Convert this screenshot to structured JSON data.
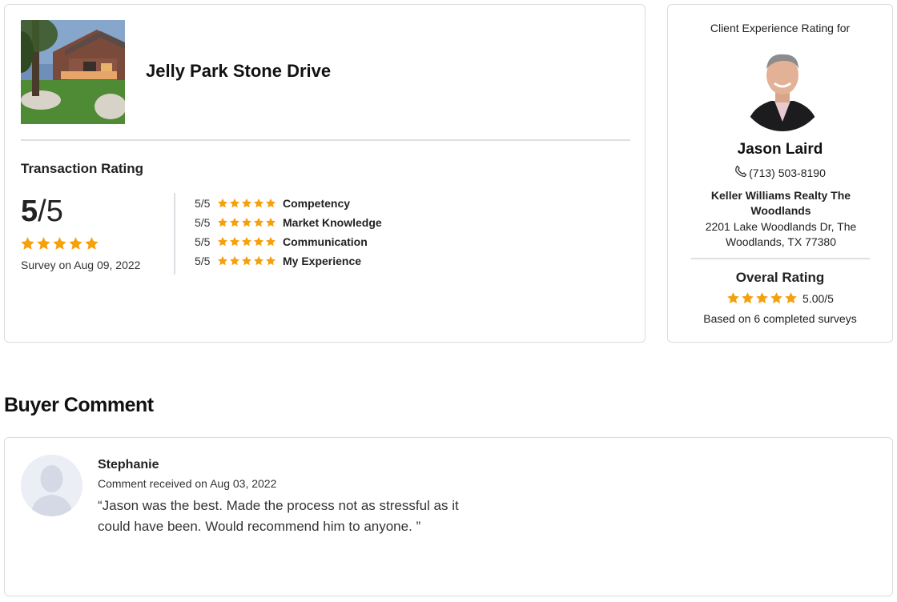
{
  "transaction": {
    "property_name": "Jelly Park Stone Drive",
    "heading": "Transaction Rating",
    "score": "5",
    "score_suffix": "/5",
    "stars": 5,
    "survey_date": "Survey on Aug 09, 2022",
    "criteria": [
      {
        "score": "5/5",
        "stars": 5,
        "label": "Competency"
      },
      {
        "score": "5/5",
        "stars": 5,
        "label": "Market Knowledge"
      },
      {
        "score": "5/5",
        "stars": 5,
        "label": "Communication"
      },
      {
        "score": "5/5",
        "stars": 5,
        "label": "My Experience"
      }
    ]
  },
  "agent": {
    "caption": "Client Experience Rating for",
    "name": "Jason Laird",
    "phone": "(713) 503-8190",
    "brokerage": "Keller Williams Realty The Woodlands",
    "address": "2201 Lake Woodlands Dr, The Woodlands, TX 77380",
    "overall_heading": "Overal Rating",
    "overall_stars": 5,
    "overall_value": "5.00/5",
    "overall_count": "Based on 6 completed surveys"
  },
  "comments": {
    "section_title": "Buyer Comment",
    "author": "Stephanie",
    "date": "Comment received on Aug 03, 2022",
    "text": "“Jason was the best. Made the process not as stressful as it could have been. Would recommend him to anyone. ”"
  },
  "colors": {
    "star": "#f5a00f",
    "border": "#d9dce1",
    "divider": "#dcdfe4"
  },
  "icons": {
    "star": "star-icon",
    "phone": "phone-icon",
    "avatar": "user-avatar-icon"
  }
}
